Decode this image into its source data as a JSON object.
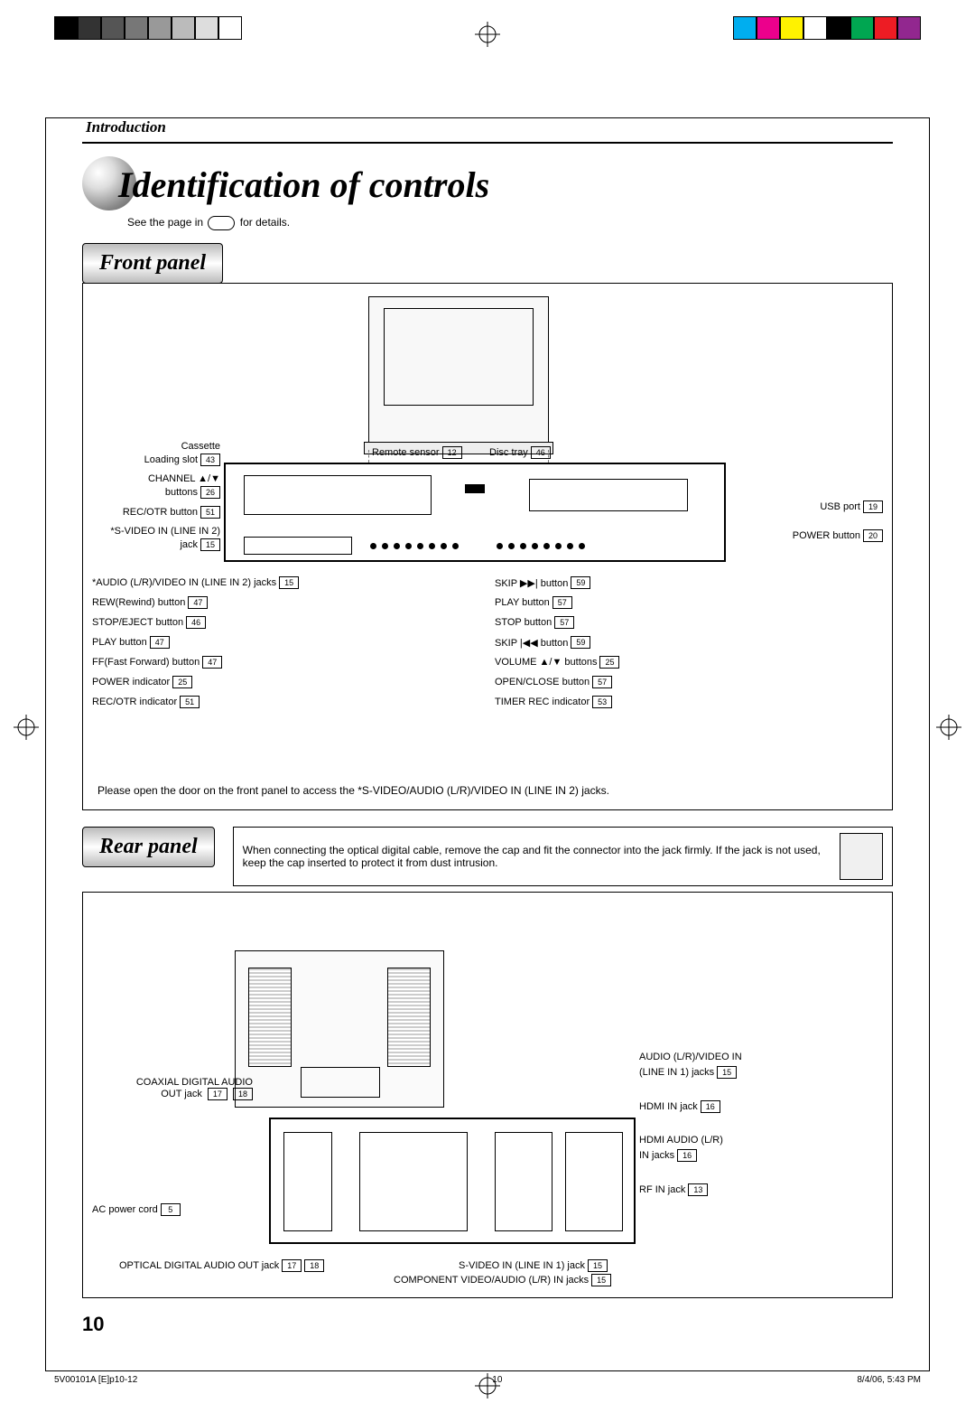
{
  "header_section": "Introduction",
  "title": "Identification of controls",
  "subnote_pre": "See the page in",
  "subnote_post": "for details.",
  "front_panel_tag": "Front panel",
  "rear_panel_tag": "Rear panel",
  "front_labels_left": [
    {
      "text": "Cassette",
      "ref": ""
    },
    {
      "text": "Loading slot",
      "ref": "43"
    },
    {
      "text": "CHANNEL ▲/▼",
      "ref": ""
    },
    {
      "text": "buttons",
      "ref": "26"
    },
    {
      "text": "REC/OTR button",
      "ref": "51"
    },
    {
      "text": "*S-VIDEO IN (LINE IN 2)",
      "ref": ""
    },
    {
      "text": "jack",
      "ref": "15"
    }
  ],
  "front_labels_left_lower": [
    {
      "text": "*AUDIO (L/R)/VIDEO IN (LINE IN 2) jacks",
      "ref": "15"
    },
    {
      "text": "REW(Rewind) button",
      "ref": "47"
    },
    {
      "text": "STOP/EJECT button",
      "ref": "46"
    },
    {
      "text": "PLAY button",
      "ref": "47"
    },
    {
      "text": "FF(Fast Forward) button",
      "ref": "47"
    },
    {
      "text": "POWER indicator",
      "ref": "25"
    },
    {
      "text": "REC/OTR indicator",
      "ref": "51"
    }
  ],
  "front_labels_top": [
    {
      "text": "Remote sensor",
      "ref": "12"
    },
    {
      "text": "Disc tray",
      "ref": "46"
    }
  ],
  "front_labels_right_upper": [
    {
      "text": "USB port",
      "ref": "19"
    },
    {
      "text": "POWER button",
      "ref": "20"
    }
  ],
  "front_labels_right_lower": [
    {
      "text": "SKIP ▶▶| button",
      "ref": "59"
    },
    {
      "text": "PLAY button",
      "ref": "57"
    },
    {
      "text": "STOP button",
      "ref": "57"
    },
    {
      "text": "SKIP |◀◀ button",
      "ref": "59"
    },
    {
      "text": "VOLUME ▲/▼ buttons",
      "ref": "25"
    },
    {
      "text": "OPEN/CLOSE button",
      "ref": "57"
    },
    {
      "text": "TIMER REC indicator",
      "ref": "53"
    }
  ],
  "front_note": "Please open the door on the front panel to access the *S-VIDEO/AUDIO (L/R)/VIDEO IN (LINE IN 2) jacks.",
  "rear_info": "When connecting the optical digital cable, remove the cap and fit the connector into the jack firmly. If the jack is not used, keep the cap inserted to protect it from dust intrusion.",
  "rear_labels_left": [
    {
      "text": "COAXIAL DIGITAL AUDIO",
      "ref": ""
    },
    {
      "text": "OUT jack",
      "ref": "17",
      "ref2": "18"
    },
    {
      "text": "AC power cord",
      "ref": "5"
    }
  ],
  "rear_labels_right": [
    {
      "text": "AUDIO (L/R)/VIDEO IN",
      "ref": ""
    },
    {
      "text": "(LINE IN 1) jacks",
      "ref": "15"
    },
    {
      "text": "HDMI IN jack",
      "ref": "16"
    },
    {
      "text": "HDMI AUDIO (L/R)",
      "ref": ""
    },
    {
      "text": "IN jacks",
      "ref": "16"
    },
    {
      "text": "RF IN jack",
      "ref": "13"
    }
  ],
  "rear_labels_bottom": [
    {
      "text": "OPTICAL DIGITAL AUDIO OUT jack",
      "ref": "17",
      "ref2": "18"
    },
    {
      "text": "S-VIDEO IN (LINE IN 1) jack",
      "ref": "15"
    },
    {
      "text": "COMPONENT VIDEO/AUDIO (L/R) IN jacks",
      "ref": "15"
    }
  ],
  "page_number": "10",
  "footer": {
    "file": "5V00101A [E]p10-12",
    "page": "10",
    "timestamp": "8/4/06, 5:43 PM"
  },
  "color_swatches_left": [
    "#000",
    "#333",
    "#555",
    "#777",
    "#999",
    "#bbb",
    "#ddd",
    "#fff"
  ],
  "color_swatches_right": [
    "#00aeef",
    "#ec008c",
    "#fff200",
    "#fff",
    "#000",
    "#00a651",
    "#ed1c24",
    "#92278f"
  ]
}
